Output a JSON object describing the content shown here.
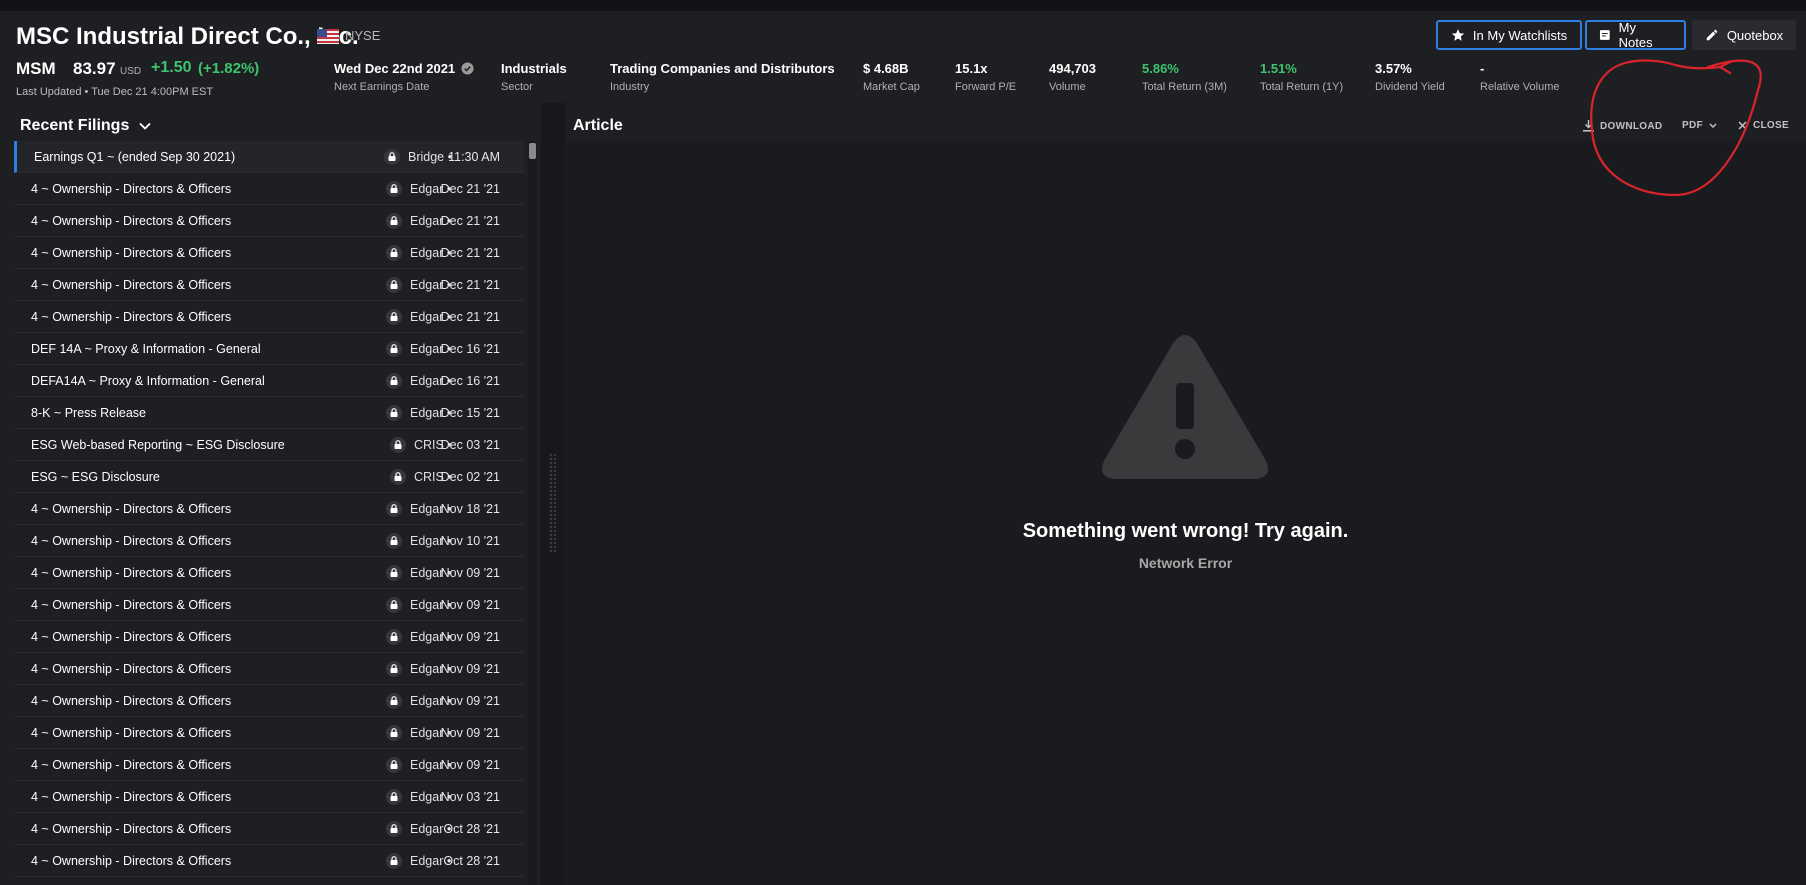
{
  "header": {
    "company_name": "MSC Industrial Direct Co., Inc.",
    "exchange": "NYSE",
    "buttons": {
      "watchlists": "In My Watchlists",
      "notes": "My Notes",
      "quotebox": "Quotebox"
    },
    "quote": {
      "ticker": "MSM",
      "price": "83.97",
      "currency": "USD",
      "change": "+1.50",
      "change_pct": "(+1.82%)",
      "last_updated": "Last Updated • Tue Dec 21 4:00PM EST"
    },
    "stats": [
      {
        "value": "Wed Dec 22nd 2021",
        "label": "Next Earnings Date"
      },
      {
        "value": "Industrials",
        "label": "Sector"
      },
      {
        "value": "Trading Companies and Distributors",
        "label": "Industry"
      },
      {
        "value": "$ 4.68B",
        "label": "Market Cap"
      },
      {
        "value": "15.1x",
        "label": "Forward P/E"
      },
      {
        "value": "494,703",
        "label": "Volume"
      },
      {
        "value": "5.86%",
        "label": "Total Return (3M)"
      },
      {
        "value": "1.51%",
        "label": "Total Return (1Y)"
      },
      {
        "value": "3.57%",
        "label": "Dividend Yield"
      },
      {
        "value": "-",
        "label": "Relative Volume"
      }
    ]
  },
  "filings": {
    "title": "Recent Filings",
    "items": [
      {
        "title": "Earnings Q1 ~ (ended Sep 30 2021)",
        "source": "Bridge •",
        "date": "11:30 AM"
      },
      {
        "title": "4 ~ Ownership - Directors & Officers",
        "source": "Edgar •",
        "date": "Dec 21 '21"
      },
      {
        "title": "4 ~ Ownership - Directors & Officers",
        "source": "Edgar •",
        "date": "Dec 21 '21"
      },
      {
        "title": "4 ~ Ownership - Directors & Officers",
        "source": "Edgar •",
        "date": "Dec 21 '21"
      },
      {
        "title": "4 ~ Ownership - Directors & Officers",
        "source": "Edgar •",
        "date": "Dec 21 '21"
      },
      {
        "title": "4 ~ Ownership - Directors & Officers",
        "source": "Edgar •",
        "date": "Dec 21 '21"
      },
      {
        "title": "DEF 14A ~ Proxy & Information - General",
        "source": "Edgar •",
        "date": "Dec 16 '21"
      },
      {
        "title": "DEFA14A ~ Proxy & Information - General",
        "source": "Edgar •",
        "date": "Dec 16 '21"
      },
      {
        "title": "8-K ~ Press Release",
        "source": "Edgar •",
        "date": "Dec 15 '21"
      },
      {
        "title": "ESG Web-based Reporting ~ ESG Disclosure",
        "source": "CRIS •",
        "date": "Dec 03 '21"
      },
      {
        "title": "ESG ~ ESG Disclosure",
        "source": "CRIS •",
        "date": "Dec 02 '21"
      },
      {
        "title": "4 ~ Ownership - Directors & Officers",
        "source": "Edgar •",
        "date": "Nov 18 '21"
      },
      {
        "title": "4 ~ Ownership - Directors & Officers",
        "source": "Edgar •",
        "date": "Nov 10 '21"
      },
      {
        "title": "4 ~ Ownership - Directors & Officers",
        "source": "Edgar •",
        "date": "Nov 09 '21"
      },
      {
        "title": "4 ~ Ownership - Directors & Officers",
        "source": "Edgar •",
        "date": "Nov 09 '21"
      },
      {
        "title": "4 ~ Ownership - Directors & Officers",
        "source": "Edgar •",
        "date": "Nov 09 '21"
      },
      {
        "title": "4 ~ Ownership - Directors & Officers",
        "source": "Edgar •",
        "date": "Nov 09 '21"
      },
      {
        "title": "4 ~ Ownership - Directors & Officers",
        "source": "Edgar •",
        "date": "Nov 09 '21"
      },
      {
        "title": "4 ~ Ownership - Directors & Officers",
        "source": "Edgar •",
        "date": "Nov 09 '21"
      },
      {
        "title": "4 ~ Ownership - Directors & Officers",
        "source": "Edgar •",
        "date": "Nov 09 '21"
      },
      {
        "title": "4 ~ Ownership - Directors & Officers",
        "source": "Edgar •",
        "date": "Nov 03 '21"
      },
      {
        "title": "4 ~ Ownership - Directors & Officers",
        "source": "Edgar •",
        "date": "Oct 28 '21"
      },
      {
        "title": "4 ~ Ownership - Directors & Officers",
        "source": "Edgar •",
        "date": "Oct 28 '21"
      }
    ]
  },
  "article": {
    "title": "Article",
    "download_label": "DOWNLOAD",
    "format_label": "PDF",
    "close_label": "CLOSE",
    "error_title": "Something went wrong! Try again.",
    "error_message": "Network Error"
  },
  "colors": {
    "accent": "#2f7fe0",
    "positive": "#3ec46d",
    "annotation": "#d9242b",
    "background": "#1a1b1e"
  },
  "icons": [
    "us-flag-icon",
    "star-icon",
    "note-icon",
    "pencil-icon",
    "chevron-down-icon",
    "lock-icon",
    "download-icon",
    "close-icon",
    "warning-icon"
  ]
}
